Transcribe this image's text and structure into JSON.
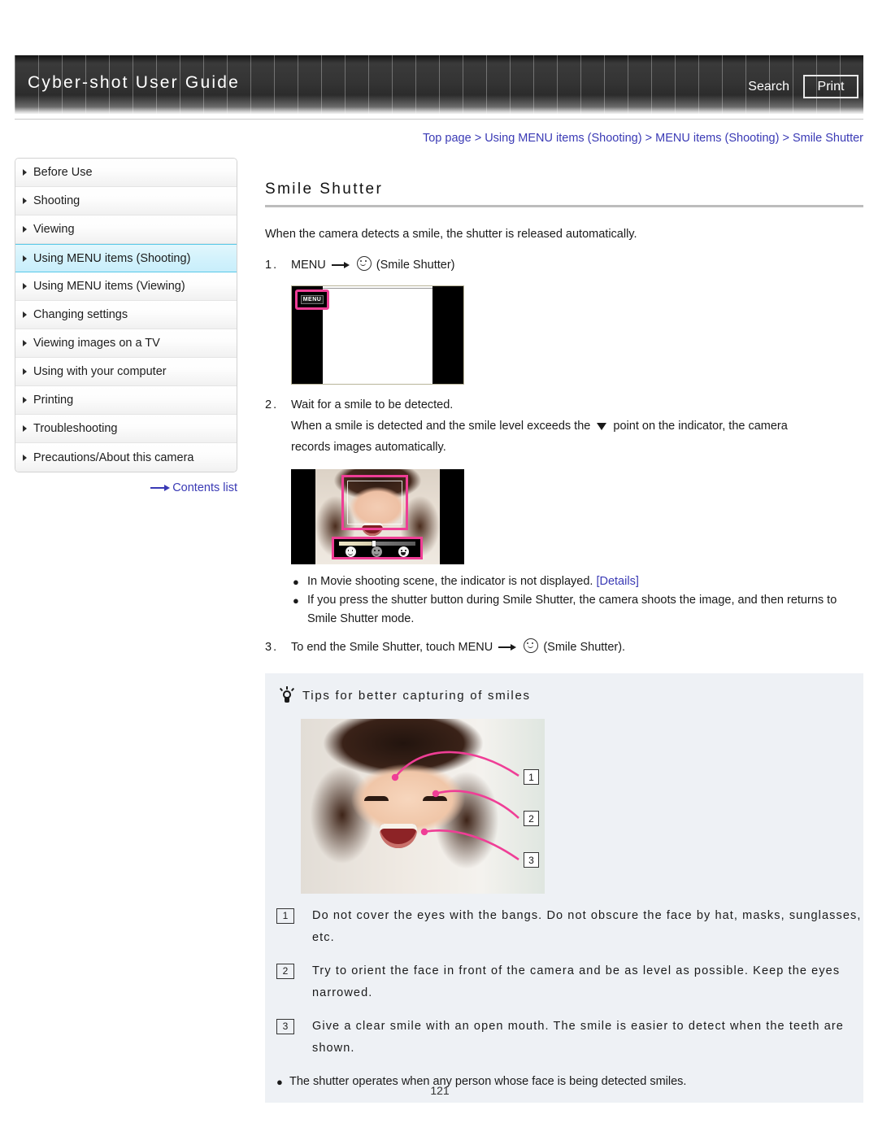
{
  "header": {
    "title": "Cyber-shot User Guide",
    "search_label": "Search",
    "print_label": "Print"
  },
  "breadcrumb": {
    "items": [
      "Top page",
      "Using MENU items (Shooting)",
      "MENU items (Shooting)",
      "Smile Shutter"
    ],
    "separator": ">",
    "color": "#3a3ab5"
  },
  "sidebar": {
    "items": [
      {
        "label": "Before Use",
        "selected": false
      },
      {
        "label": "Shooting",
        "selected": false
      },
      {
        "label": "Viewing",
        "selected": false
      },
      {
        "label": "Using MENU items (Shooting)",
        "selected": true
      },
      {
        "label": "Using MENU items (Viewing)",
        "selected": false
      },
      {
        "label": "Changing settings",
        "selected": false
      },
      {
        "label": "Viewing images on a TV",
        "selected": false
      },
      {
        "label": "Using with your computer",
        "selected": false
      },
      {
        "label": "Printing",
        "selected": false
      },
      {
        "label": "Troubleshooting",
        "selected": false
      },
      {
        "label": "Precautions/About this camera",
        "selected": false
      }
    ],
    "contents_link": "Contents list",
    "selected_highlight_color": "#c8eefb"
  },
  "main": {
    "title": "Smile Shutter",
    "intro": "When the camera detects a smile, the shutter is released automatically.",
    "step1": {
      "number": "1.",
      "prefix": "MENU",
      "suffix": "(Smile Shutter)"
    },
    "camera_screen_1": {
      "menu_button_label": "MENU",
      "highlight_color": "#ef3e96"
    },
    "step2": {
      "number": "2.",
      "line1": "Wait for a smile to be detected.",
      "line2_part1": "When a smile is detected and the smile level exceeds the",
      "line2_part2": "point on the indicator, the camera",
      "line3": "records images automatically."
    },
    "camera_screen_2": {
      "highlight_color": "#ef3e96"
    },
    "bullets": [
      {
        "text": "In Movie shooting scene, the indicator is not displayed.",
        "link": "[Details]"
      },
      {
        "text": "If you press the shutter button during Smile Shutter, the camera shoots the image, and then returns to Smile Shutter mode.",
        "link": ""
      }
    ],
    "step3": {
      "number": "3.",
      "prefix": "To end the Smile Shutter, touch MENU",
      "suffix": "(Smile Shutter)."
    }
  },
  "tips": {
    "heading": "Tips for better capturing of smiles",
    "callout_numbers": [
      "1",
      "2",
      "3"
    ],
    "items": [
      {
        "badge": "1",
        "text": "Do not cover the eyes with the bangs. Do not obscure the face by hat, masks, sunglasses, etc."
      },
      {
        "badge": "2",
        "text": "Try to orient the face in front of the camera and be as level as possible. Keep the eyes narrowed."
      },
      {
        "badge": "3",
        "text": "Give a clear smile with an open mouth. The smile is easier to detect when the teeth are shown."
      }
    ],
    "footnote": "The shutter operates when any person whose face is being detected smiles."
  },
  "footer": {
    "page_number": "121"
  }
}
